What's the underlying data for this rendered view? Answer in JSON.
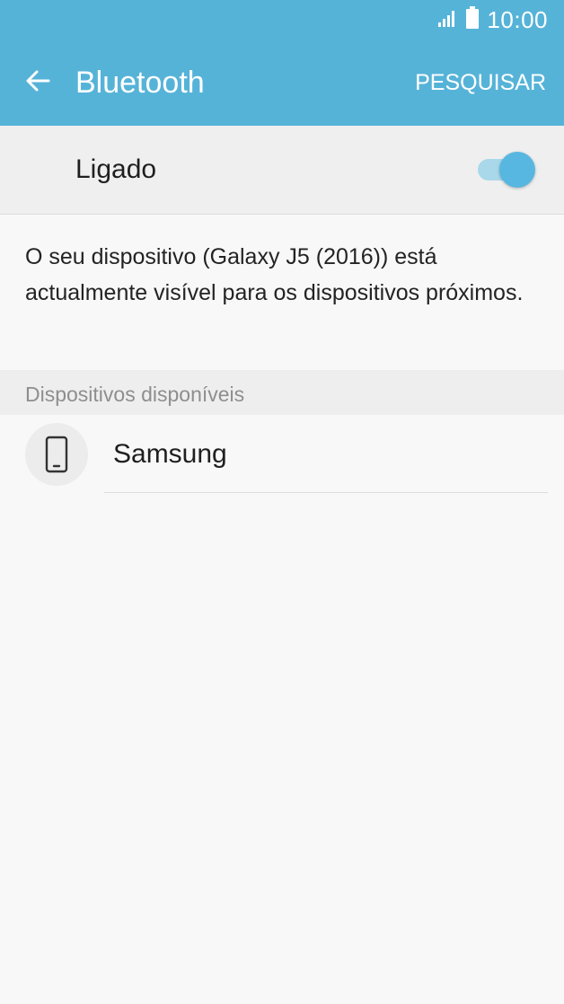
{
  "status_bar": {
    "time": "10:00",
    "icons": [
      "signal-icon",
      "battery-icon"
    ]
  },
  "app_bar": {
    "back_icon": "arrow-left-icon",
    "title": "Bluetooth",
    "action_label": "PESQUISAR"
  },
  "bluetooth_toggle": {
    "label": "Ligado",
    "checked": true
  },
  "visibility_message": "O seu dispositivo (Galaxy J5 (2016)) está actualmente visível para os dispositivos próximos.",
  "available_devices": {
    "header": "Dispositivos disponíveis",
    "items": [
      {
        "name": "Samsung",
        "icon": "smartphone-icon"
      }
    ]
  },
  "colors": {
    "app_bar": "#56b3d8",
    "switch_thumb": "#58b7e0",
    "switch_track": "#a8d8ea",
    "background": "#f8f8f8"
  }
}
